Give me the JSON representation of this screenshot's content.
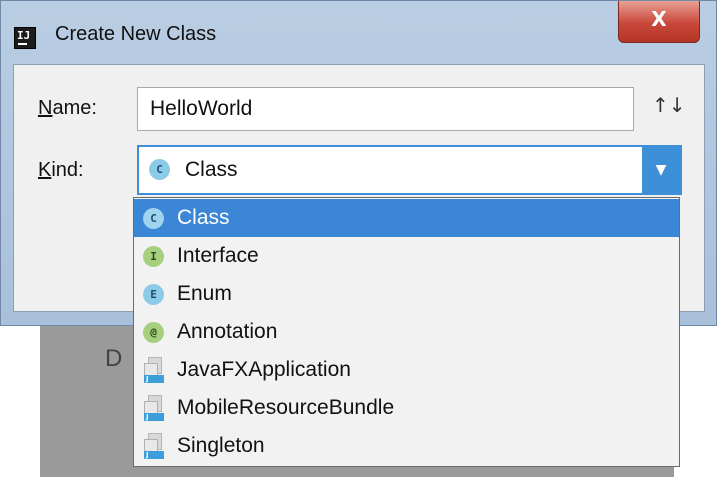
{
  "window": {
    "title": "Create New Class",
    "app_icon_text": "IJ",
    "close_label": "X"
  },
  "form": {
    "name_label_mnemonic": "N",
    "name_label_rest": "ame:",
    "name_value": "HelloWorld",
    "kind_label_mnemonic": "K",
    "kind_label_rest": "ind:",
    "kind_value": "Class",
    "kind_badge": "C",
    "sort_icon": "↑↓"
  },
  "dropdown": {
    "arrow": "▼",
    "selected_index": 0,
    "items": [
      {
        "label": "Class",
        "badge": "C",
        "icon": "class-icon"
      },
      {
        "label": "Interface",
        "badge": "I",
        "icon": "interface-icon"
      },
      {
        "label": "Enum",
        "badge": "E",
        "icon": "enum-icon"
      },
      {
        "label": "Annotation",
        "badge": "@",
        "icon": "annotation-icon"
      },
      {
        "label": "JavaFXApplication",
        "badge": "J",
        "icon": "java-file-icon"
      },
      {
        "label": "MobileResourceBundle",
        "badge": "J",
        "icon": "java-file-icon"
      },
      {
        "label": "Singleton",
        "badge": "J",
        "icon": "java-file-icon"
      }
    ]
  },
  "background": {
    "partial_letter": "D"
  },
  "colors": {
    "accent": "#3c86d6",
    "close_red": "#c8473a",
    "class_badge": "#8ccbe8",
    "interface_badge": "#a6d07e"
  }
}
